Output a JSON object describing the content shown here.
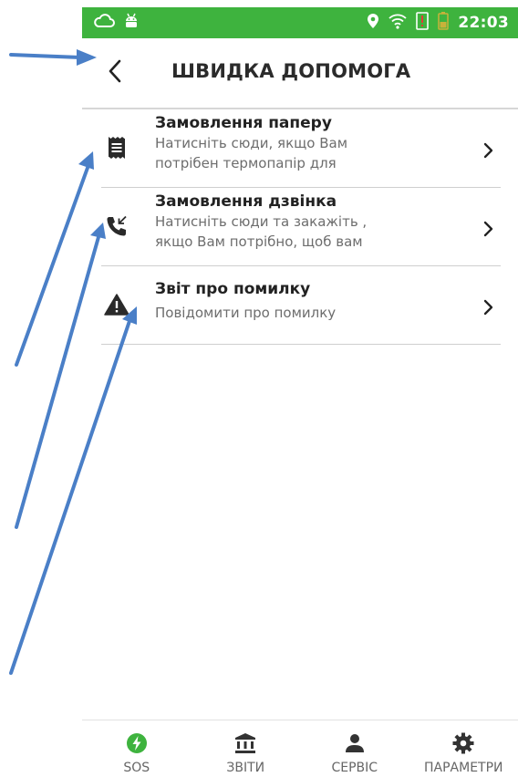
{
  "status_bar": {
    "time": "22:03",
    "left_icons": [
      "cloud-icon",
      "android-icon"
    ],
    "right_icons": [
      "location-pin-icon",
      "wifi-icon",
      "sim-alert-icon",
      "battery-icon"
    ],
    "background": "#3eb33e"
  },
  "header": {
    "title": "ШВИДКА ДОПОМОГА",
    "back_icon": "back-chevron-icon"
  },
  "items": [
    {
      "title": "Замовлення паперу",
      "subtitle_line1": "Натисніть сюди, якщо Вам",
      "subtitle_line2": "потрібен термопапір для",
      "icon": "receipt-icon"
    },
    {
      "title": "Замовлення дзвінка",
      "subtitle_line1": "Натисніть сюди та закажіть ,",
      "subtitle_line2": "якщо Вам потрібно, щоб вам",
      "icon": "callback-phone-icon"
    },
    {
      "title": "Звіт про помилку",
      "subtitle_line1": "Повідомити про помилку",
      "icon": "warning-icon"
    }
  ],
  "bottom_nav": [
    {
      "label": "SOS",
      "icon": "sos-bolt-icon",
      "active": true
    },
    {
      "label": "ЗВІТИ",
      "icon": "bank-icon"
    },
    {
      "label": "СЕРВІС",
      "icon": "person-icon"
    },
    {
      "label": "ПАРАМЕТРИ",
      "icon": "gear-icon"
    }
  ],
  "colors": {
    "accent": "#3eb33e",
    "annotation_arrow": "#4a7fc7"
  }
}
